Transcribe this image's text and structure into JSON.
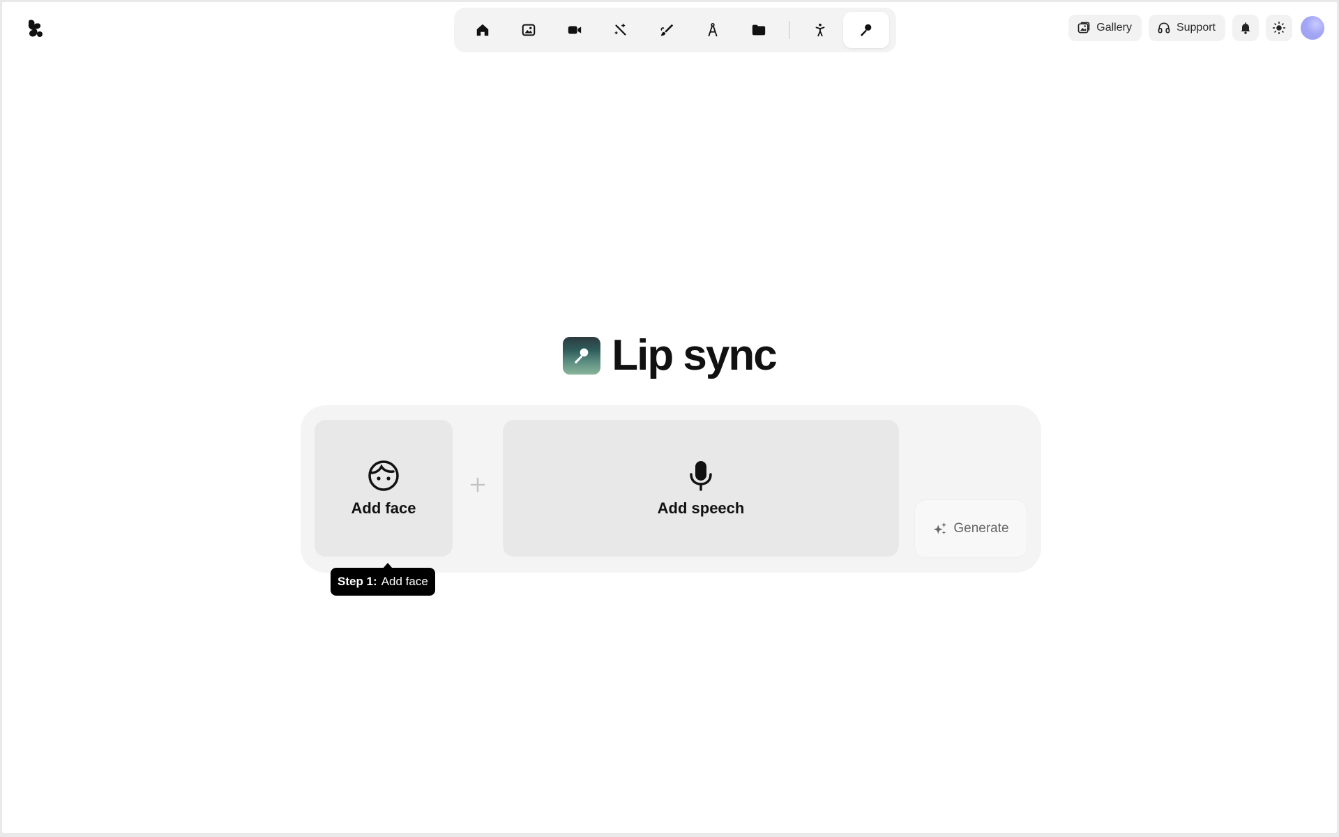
{
  "app": {
    "logo_icon": "app-logo-icon"
  },
  "toolbar": {
    "tools": [
      {
        "icon": "home-icon",
        "active": false
      },
      {
        "icon": "image-icon",
        "active": false
      },
      {
        "icon": "video-camera-icon",
        "active": false
      },
      {
        "icon": "magic-wand-icon",
        "active": false
      },
      {
        "icon": "brush-icon",
        "active": false
      },
      {
        "icon": "compass-icon",
        "active": false
      },
      {
        "icon": "folder-icon",
        "active": false
      },
      {
        "icon": "person-icon",
        "active": false
      },
      {
        "icon": "microphone-icon",
        "active": true
      }
    ]
  },
  "header": {
    "gallery_label": "Gallery",
    "support_label": "Support",
    "notifications_icon": "bell-icon",
    "theme_icon": "sun-icon",
    "avatar_color": "#a3a6f5"
  },
  "main": {
    "title": "Lip sync",
    "face_card_label": "Add face",
    "speech_card_label": "Add speech",
    "generate_label": "Generate",
    "tooltip": {
      "step": "Step 1:",
      "action": "Add face"
    }
  },
  "colors": {
    "panel_bg": "#f4f4f4",
    "card_bg": "#e8e8e8",
    "tooltip_bg": "#000000"
  }
}
